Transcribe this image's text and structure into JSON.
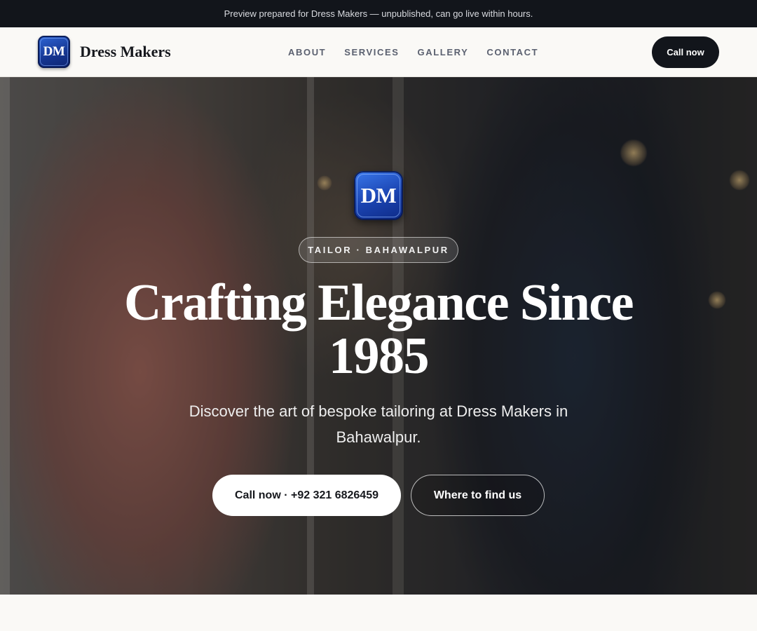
{
  "announcement": "Preview prepared for Dress Makers — unpublished, can go live within hours.",
  "brand": {
    "logo_text": "DM",
    "name": "Dress Makers"
  },
  "nav": {
    "links": [
      "ABOUT",
      "SERVICES",
      "GALLERY",
      "CONTACT"
    ],
    "cta_label": "Call now"
  },
  "hero": {
    "logo_text": "DM",
    "tag": "TAILOR · BAHAWALPUR",
    "headline": "Crafting Elegance Since 1985",
    "subtext": "Discover the art of bespoke tailoring at Dress Makers in Bahawalpur.",
    "primary_button": "Call now · +92 321 6826459",
    "secondary_button": "Where to find us"
  },
  "colors": {
    "dark": "#12151b",
    "logo_blue": "#1a43b0",
    "page_bg": "#faf9f6"
  }
}
